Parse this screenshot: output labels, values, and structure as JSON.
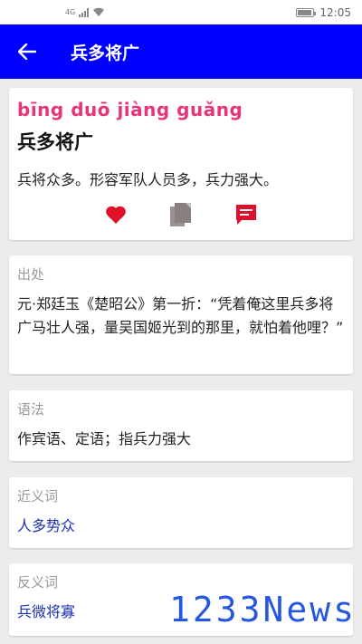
{
  "status": {
    "network": "4G",
    "time": "12:05",
    "battery_level": 0.85
  },
  "appbar": {
    "title": "兵多将广"
  },
  "entry": {
    "pinyin": "bīng duō jiàng guǎng",
    "word": "兵多将广",
    "meaning": "兵将众多。形容军队人员多，兵力强大。",
    "actions": {
      "favorite_icon": "heart-icon",
      "copy_icon": "copy-icon",
      "comment_icon": "comment-icon"
    }
  },
  "sections": {
    "source": {
      "label": "出处",
      "content": "元·郑廷玉《楚昭公》第一折：“凭着俺这里兵多将广马壮人强，量吴国姬光到的那里，就怕着他哩？”"
    },
    "grammar": {
      "label": "语法",
      "content": "作宾语、定语；指兵力强大"
    },
    "synonym": {
      "label": "近义词",
      "content": "人多势众"
    },
    "antonym": {
      "label": "反义词",
      "content": "兵微将寡"
    }
  },
  "watermark": "1233News",
  "colors": {
    "appbar": "#0000ff",
    "pinyin": "#e8347a",
    "link": "#1a2fb0",
    "heart": "#e0102a"
  }
}
